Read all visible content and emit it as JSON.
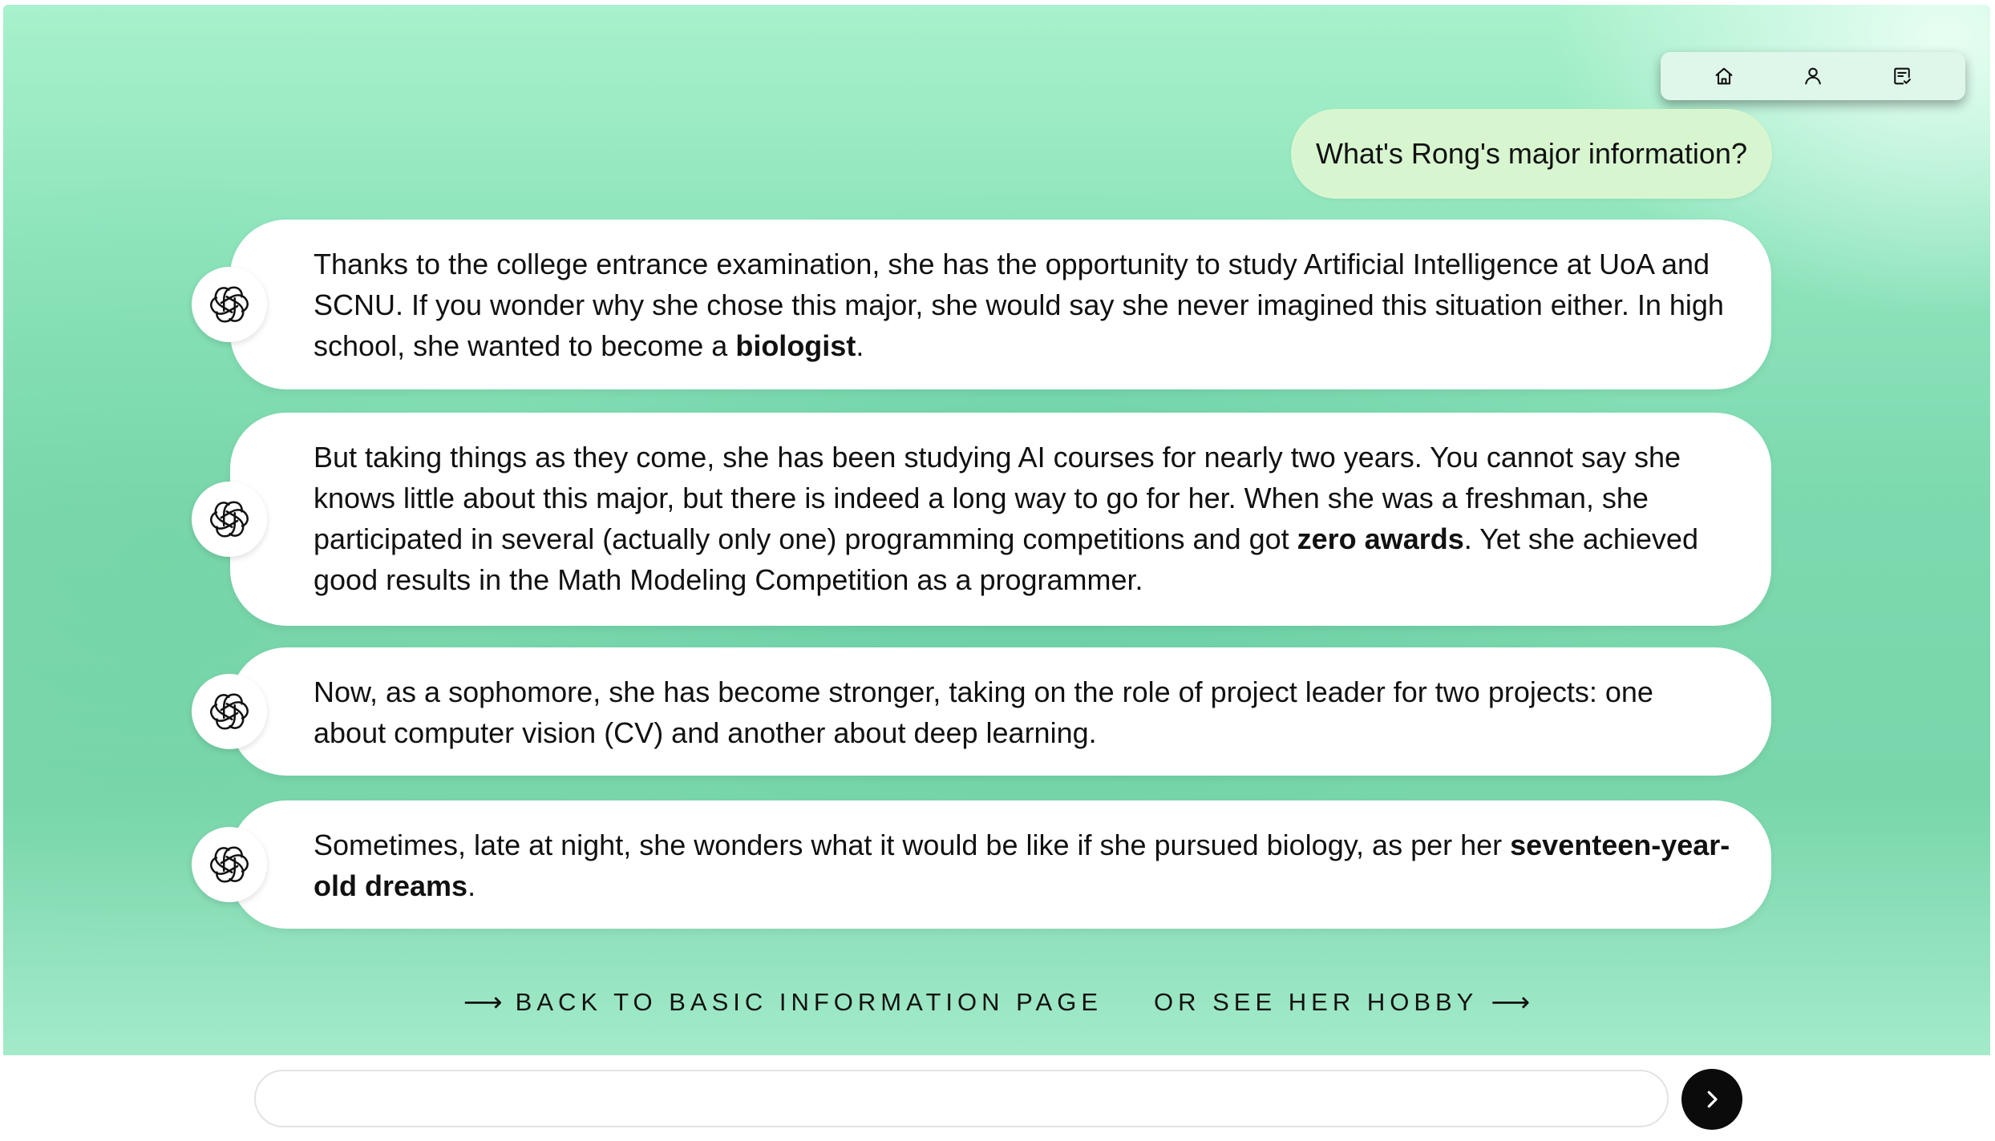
{
  "nav": {
    "items": [
      {
        "icon": "home-icon"
      },
      {
        "icon": "user-icon"
      },
      {
        "icon": "notes-icon"
      }
    ]
  },
  "user_question": "What's Rong's major information?",
  "messages": [
    {
      "avatar_icon": "chatgpt-logo-icon",
      "parts": [
        {
          "text": "Thanks to the college entrance examination, she has the opportunity to study Artificial Intelligence at UoA and SCNU. If you wonder why she chose this major, she would say she never imagined this situation either. In high school, she wanted to become a "
        },
        {
          "text": "biologist",
          "bold": true
        },
        {
          "text": "."
        }
      ]
    },
    {
      "avatar_icon": "chatgpt-logo-icon",
      "parts": [
        {
          "text": "But taking things as they come, she has been studying AI courses for nearly two years. You cannot say she knows little about this major, but there is indeed a long way to go for her. When she was a freshman, she participated in several (actually only one) programming competitions and got "
        },
        {
          "text": "zero awards",
          "bold": true
        },
        {
          "text": ". Yet she achieved good results in the Math Modeling Competition as a programmer."
        }
      ]
    },
    {
      "avatar_icon": "chatgpt-logo-icon",
      "parts": [
        {
          "text": "Now, as a sophomore, she has become stronger, taking on the role of project leader for two projects: one about computer vision (CV) and another about deep learning."
        }
      ]
    },
    {
      "avatar_icon": "chatgpt-logo-icon",
      "parts": [
        {
          "text": "Sometimes, late at night, she wonders what it would be like if she pursued biology, as per her "
        },
        {
          "text": "seventeen-year-old dreams",
          "bold": true
        },
        {
          "text": "."
        }
      ]
    }
  ],
  "links": {
    "back": {
      "arrow": "⟶",
      "label": "BACK TO BASIC INFORMATION PAGE"
    },
    "hobby": {
      "label": "OR SEE HER HOBBY",
      "arrow": "⟶"
    }
  },
  "chat_input": {
    "value": "",
    "placeholder": ""
  },
  "send_button": {
    "icon": "chevron-right-icon"
  }
}
